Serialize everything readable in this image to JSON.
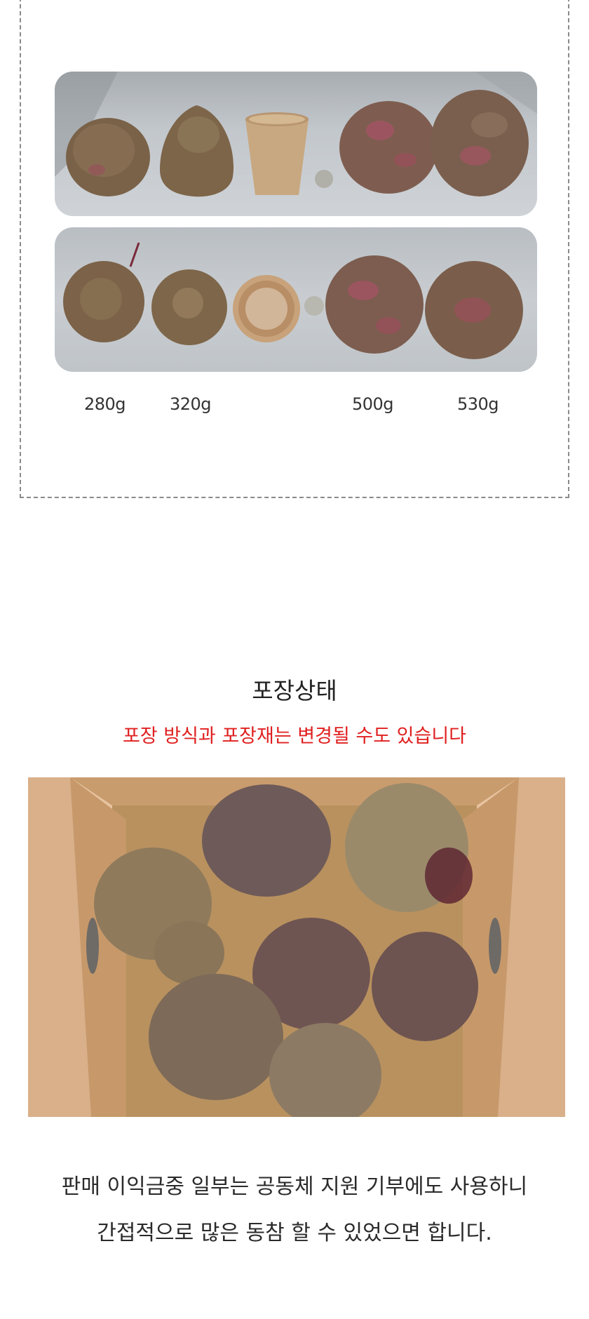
{
  "comparison": {
    "weights": [
      "280g",
      "320g",
      "500g",
      "530g"
    ]
  },
  "packaging": {
    "heading": "포장상태",
    "notice": "포장 방식과 포장재는 변경될 수도 있습니다"
  },
  "footer": {
    "line1": "판매 이익금중 일부는 공동체 지원 기부에도 사용하니",
    "line2": "간접적으로 많은 동참 할 수 있었으면 합니다."
  },
  "colors": {
    "notice": "#e02020",
    "beet_skin": "#7a6248",
    "cardboard": "#c9a070"
  }
}
